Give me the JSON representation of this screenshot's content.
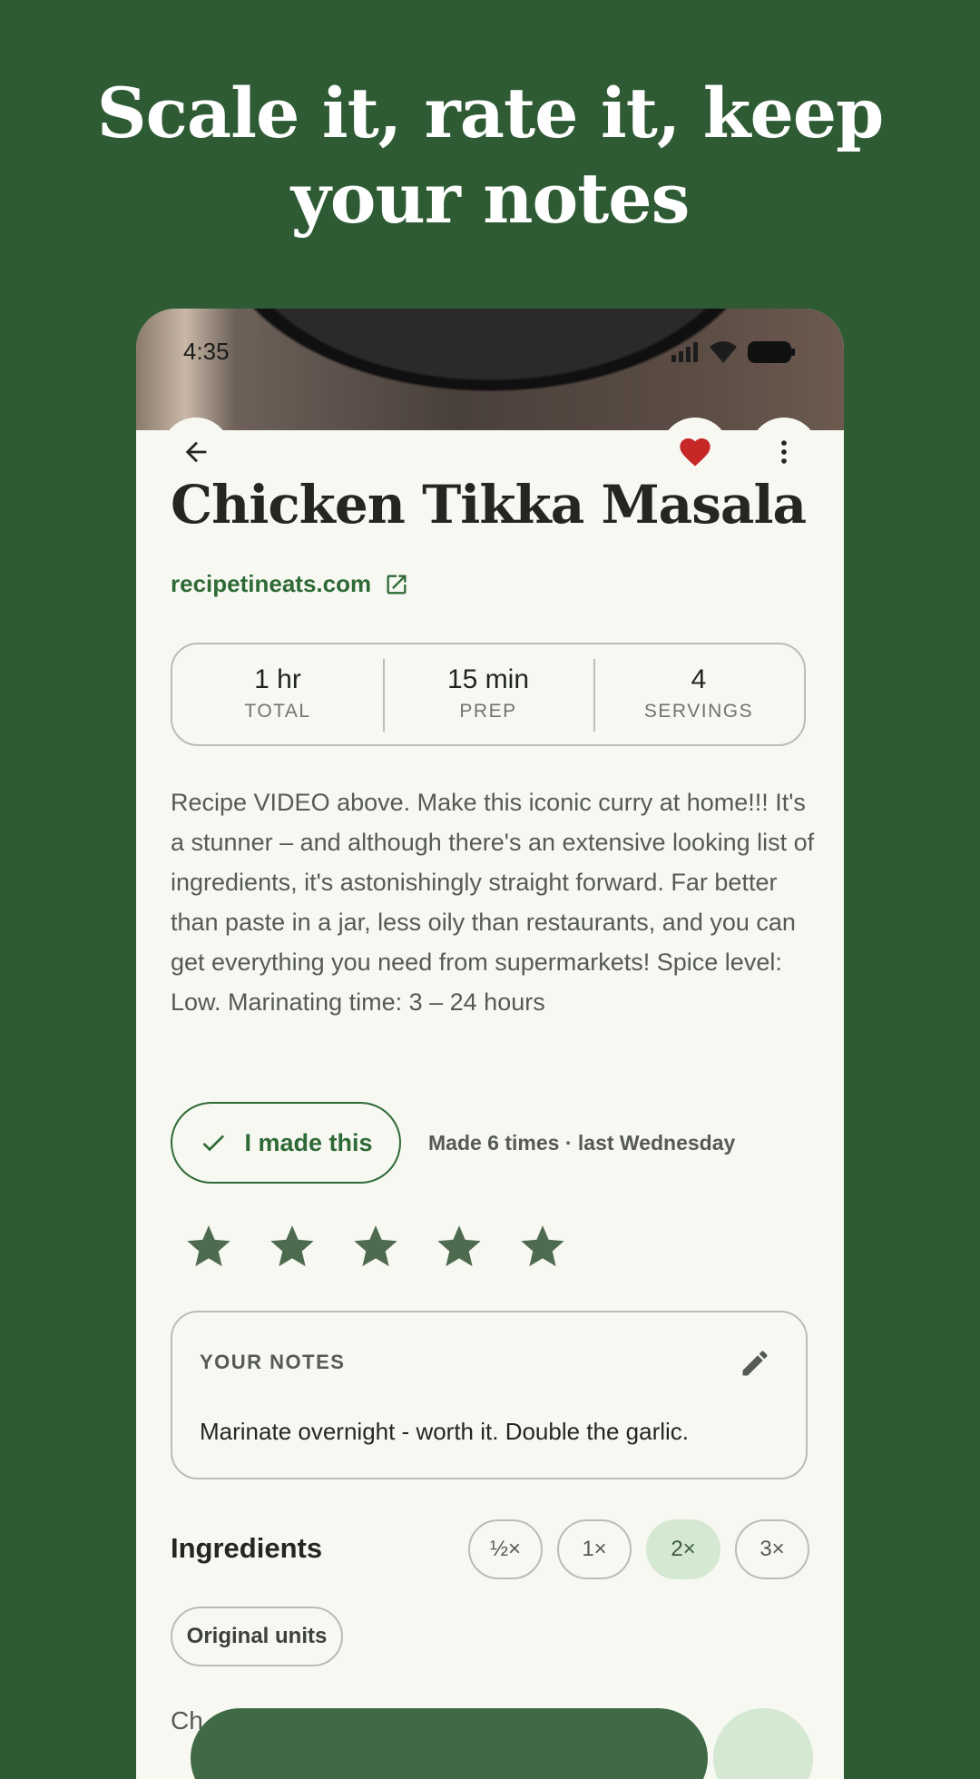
{
  "headline": {
    "line1": "Scale it, rate it, keep",
    "line2": "your notes"
  },
  "status_bar": {
    "time": "4:35"
  },
  "recipe": {
    "title": "Chicken Tikka Masala",
    "source": "recipetineats.com",
    "favorited": true,
    "stats": [
      {
        "value": "1 hr",
        "label": "TOTAL"
      },
      {
        "value": "15 min",
        "label": "PREP"
      },
      {
        "value": "4",
        "label": "SERVINGS"
      }
    ],
    "description": "Recipe VIDEO above. Make this iconic curry at home!!! It's a stunner – and although there's an extensive looking list of ingredients, it's astonishingly straight forward. Far better than paste in a jar, less oily than restaurants, and you can get everything you need from supermarkets! Spice level: Low. Marinating time: 3 – 24 hours",
    "made_button_label": "I made this",
    "made_count_text": "Made 6 times · last Wednesday",
    "rating": 5,
    "rating_max": 5
  },
  "notes": {
    "heading": "YOUR NOTES",
    "text": "Marinate overnight - worth it. Double the garlic."
  },
  "ingredients": {
    "title": "Ingredients",
    "scale_options": [
      "½×",
      "1×",
      "2×",
      "3×"
    ],
    "selected_scale": "2×",
    "units_label": "Original units",
    "peek_text": "Ch"
  },
  "colors": {
    "background": "#2e5b34",
    "accent": "#2e6a36",
    "heart": "#c62828",
    "star": "#4e6b50",
    "chip_selected": "#d4e8d2"
  },
  "icons": {
    "back": "arrow-left-icon",
    "favorite": "heart-icon",
    "menu": "more-vertical-icon",
    "external": "open-external-icon",
    "check": "check-icon",
    "edit": "pencil-icon",
    "star": "star-icon"
  }
}
